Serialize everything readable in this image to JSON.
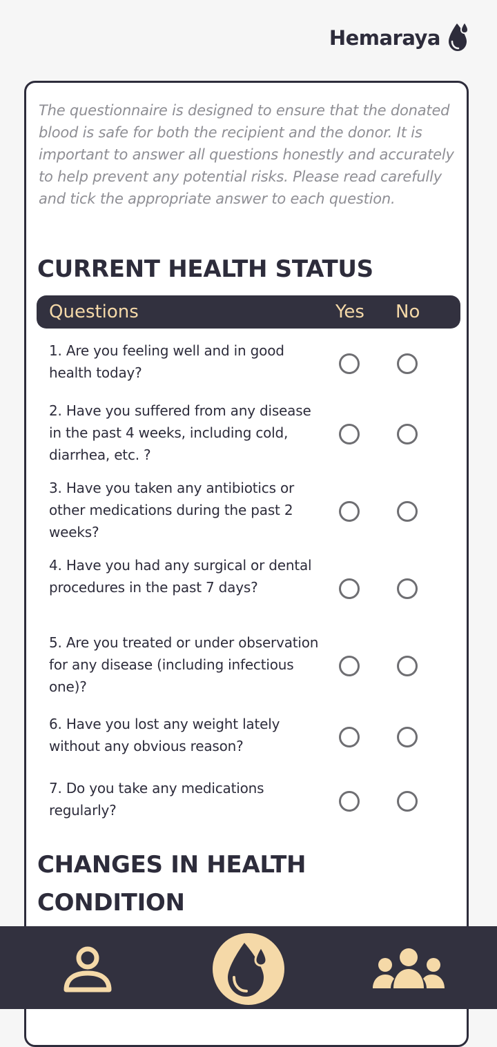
{
  "app": {
    "brand": "Hemaraya"
  },
  "intro": "The questionnaire is designed to ensure that the donated blood is safe for both the recipient and the donor. It is important to answer all questions honestly and accurately to help prevent any potential risks. Please read carefully and tick the appropriate answer to each question.",
  "sections": [
    {
      "title": "CURRENT HEALTH STATUS"
    },
    {
      "title": "CHANGES IN HEALTH CONDITION"
    }
  ],
  "table": {
    "col_questions": "Questions",
    "col_yes": "Yes",
    "col_no": "No"
  },
  "questions": [
    {
      "text": "1. Are you feeling well and in good health today?"
    },
    {
      "text": "2. Have you suffered from any disease in the past 4 weeks, including cold, diarrhea, etc. ?"
    },
    {
      "text": "3. Have you taken any antibiotics or other medications during the past 2 weeks?"
    },
    {
      "text": "4. Have you had any surgical or dental procedures in the past 7 days?"
    },
    {
      "text": "5. Are you treated or under observation for any disease (including infectious one)?"
    },
    {
      "text": "6. Have you lost any weight lately without any obvious reason?"
    },
    {
      "text": "7. Do you take any medications regularly?"
    }
  ],
  "icons": {
    "brand": "blood-drop-icon",
    "nav_profile": "user-icon",
    "nav_donate": "blood-drop-icon",
    "nav_community": "community-icon"
  },
  "colors": {
    "dark": "#32313f",
    "accent": "#f5d9a8",
    "radio_border": "#6e6e72"
  }
}
